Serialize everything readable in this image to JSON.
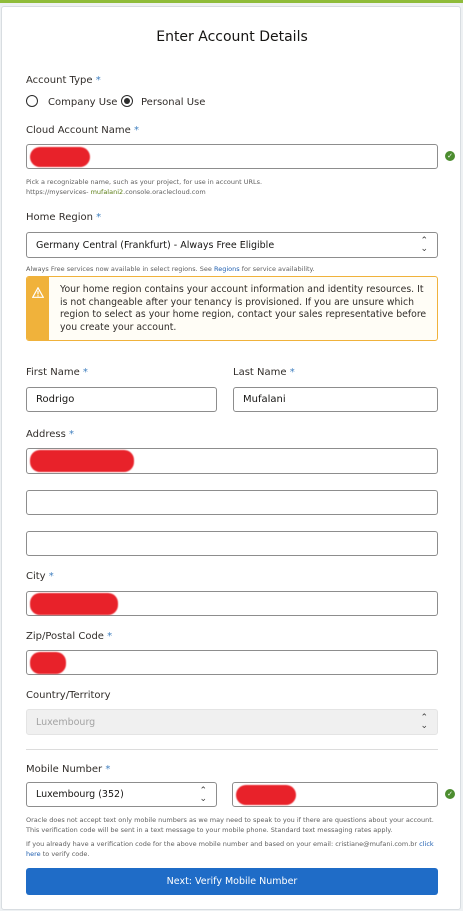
{
  "page": {
    "title": "Enter Account Details"
  },
  "account_type": {
    "label": "Account Type",
    "required_mark": "*",
    "options": [
      "Company Use",
      "Personal Use"
    ]
  },
  "cloud_account": {
    "label": "Cloud Account Name",
    "required_mark": "*",
    "help_line1": "Pick a recognizable name, such as your project, for use in account URLs.",
    "help_prefix": "https://myservices-",
    "help_name": "mufalani2",
    "help_suffix": ".console.oraclecloud.com"
  },
  "home_region": {
    "label": "Home Region",
    "required_mark": "*",
    "value": "Germany Central (Frankfurt) - Always Free Eligible",
    "help_prefix": "Always Free services now available in select regions. See",
    "help_link": "Regions",
    "help_suffix": "for service availability.",
    "warning": "Your home region contains your account information and identity resources. It is not changeable after your tenancy is provisioned. If you are unsure which region to select as your home region, contact your sales representative before you create your account."
  },
  "first_name": {
    "label": "First Name",
    "required_mark": "*",
    "value": "Rodrigo"
  },
  "last_name": {
    "label": "Last Name",
    "required_mark": "*",
    "value": "Mufalani"
  },
  "address": {
    "label": "Address",
    "required_mark": "*"
  },
  "city": {
    "label": "City",
    "required_mark": "*"
  },
  "zip": {
    "label": "Zip/Postal Code",
    "required_mark": "*"
  },
  "country": {
    "label": "Country/Territory",
    "value": "Luxembourg"
  },
  "mobile": {
    "label": "Mobile Number",
    "required_mark": "*",
    "country_code": "Luxembourg (352)",
    "notice": "Oracle does not accept text only mobile numbers as we may need to speak to you if there are questions about your account. This verification code will be sent in a text message to your mobile phone. Standard text messaging rates apply.",
    "verify_prefix": "If you already have a verification code for the above mobile number and based on your email: cristiane@mufani.com.br",
    "verify_link": "click here",
    "verify_suffix": "to verify code."
  },
  "next_button": {
    "label": "Next: Verify Mobile Number"
  },
  "icons": {
    "valid": "check-circle-icon",
    "warning": "warning-triangle-icon",
    "select": "chevron-up-down-icon"
  },
  "colors": {
    "accent": "#1f6cc7",
    "required": "#3f7fbf",
    "valid": "#4c8d2f",
    "warning": "#f0b23b",
    "redaction": "#e8222a"
  }
}
